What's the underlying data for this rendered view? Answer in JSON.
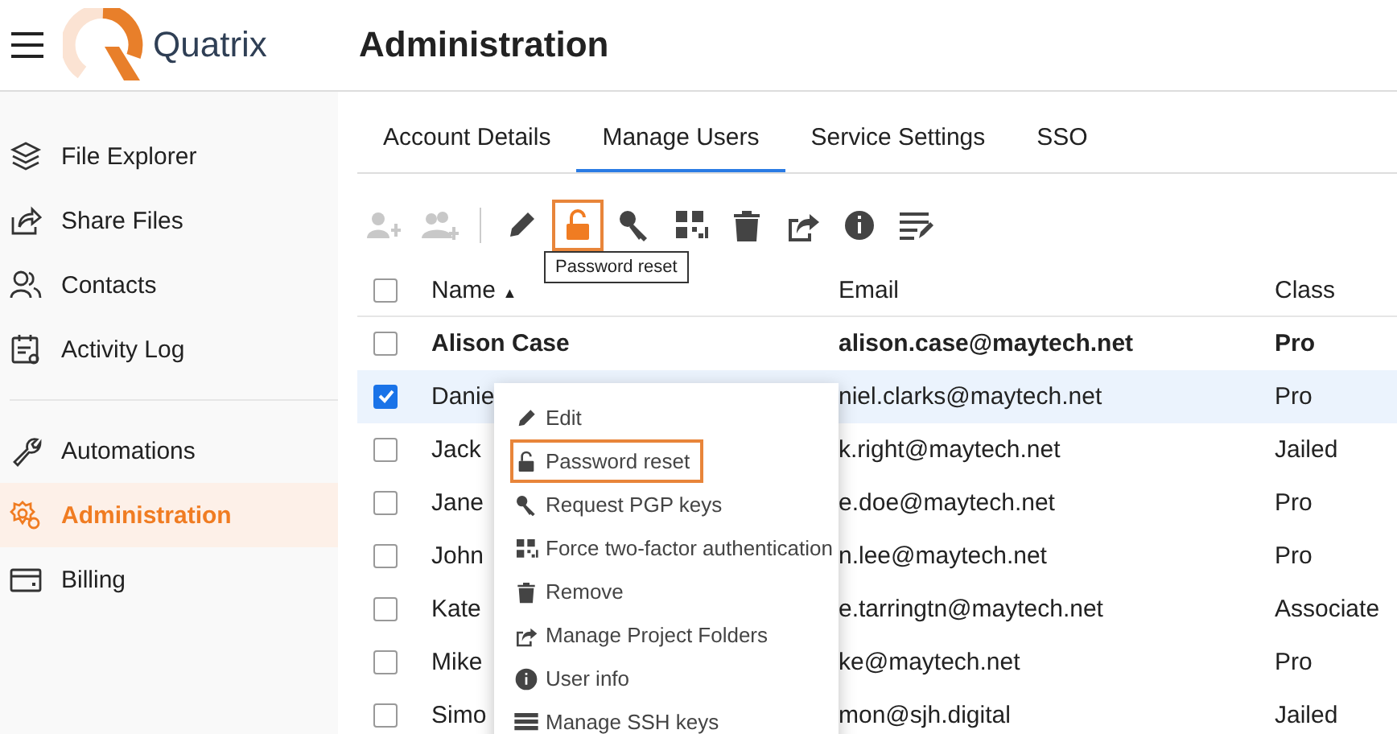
{
  "header": {
    "logo_text": "Quatrix",
    "page_title": "Administration"
  },
  "sidebar": {
    "items": [
      {
        "label": "File Explorer",
        "selected": false
      },
      {
        "label": "Share Files",
        "selected": false
      },
      {
        "label": "Contacts",
        "selected": false
      },
      {
        "label": "Activity Log",
        "selected": false
      },
      {
        "label": "Automations",
        "selected": false,
        "divider_before": true
      },
      {
        "label": "Administration",
        "selected": true
      },
      {
        "label": "Billing",
        "selected": false
      }
    ]
  },
  "tabs": [
    {
      "label": "Account Details",
      "selected": false
    },
    {
      "label": "Manage Users",
      "selected": true
    },
    {
      "label": "Service Settings",
      "selected": false
    },
    {
      "label": "SSO",
      "selected": false
    }
  ],
  "toolbar": [
    {
      "kind": "button",
      "disabled": true,
      "selected": false
    },
    {
      "kind": "button",
      "disabled": true,
      "selected": false
    },
    {
      "kind": "separator"
    },
    {
      "kind": "button",
      "disabled": false,
      "selected": false
    },
    {
      "kind": "button",
      "disabled": false,
      "selected": true,
      "tooltip": "Password reset"
    },
    {
      "kind": "button",
      "disabled": false,
      "selected": false
    },
    {
      "kind": "button",
      "disabled": false,
      "selected": false
    },
    {
      "kind": "button",
      "disabled": false,
      "selected": false
    },
    {
      "kind": "button",
      "disabled": false,
      "selected": false
    },
    {
      "kind": "button",
      "disabled": false,
      "selected": false
    },
    {
      "kind": "button",
      "disabled": false,
      "selected": false
    }
  ],
  "table": {
    "select_all_checked": false,
    "columns": [
      {
        "label": "Name",
        "sort": "▲"
      },
      {
        "label": "Email"
      },
      {
        "label": "Class"
      }
    ],
    "rows": [
      {
        "name": "Alison Case",
        "email": "alison.case@maytech.net",
        "class": "Pro",
        "bold": true,
        "checked": false
      },
      {
        "name": "Danie",
        "email": "niel.clarks@maytech.net",
        "class": "Pro",
        "bold": false,
        "checked": true
      },
      {
        "name": "Jack",
        "email": "k.right@maytech.net",
        "class": "Jailed",
        "bold": false,
        "checked": false
      },
      {
        "name": "Jane",
        "email": "e.doe@maytech.net",
        "class": "Pro",
        "bold": false,
        "checked": false
      },
      {
        "name": "John",
        "email": "n.lee@maytech.net",
        "class": "Pro",
        "bold": false,
        "checked": false
      },
      {
        "name": "Kate",
        "email": "e.tarringtn@maytech.net",
        "class": "Associate",
        "bold": false,
        "checked": false
      },
      {
        "name": "Mike",
        "email": "ke@maytech.net",
        "class": "Pro",
        "bold": false,
        "checked": false
      },
      {
        "name": "Simo",
        "email": "mon@sjh.digital",
        "class": "Jailed",
        "bold": false,
        "checked": false
      }
    ]
  },
  "context_menu": [
    {
      "label": "Edit",
      "selected": false
    },
    {
      "label": "Password reset",
      "selected": true
    },
    {
      "label": "Request PGP keys",
      "selected": false
    },
    {
      "label": "Force two-factor authentication",
      "selected": false
    },
    {
      "label": "Remove",
      "selected": false
    },
    {
      "label": "Manage Project Folders",
      "selected": false
    },
    {
      "label": "User info",
      "selected": false
    },
    {
      "label": "Manage SSH keys",
      "selected": false
    }
  ]
}
